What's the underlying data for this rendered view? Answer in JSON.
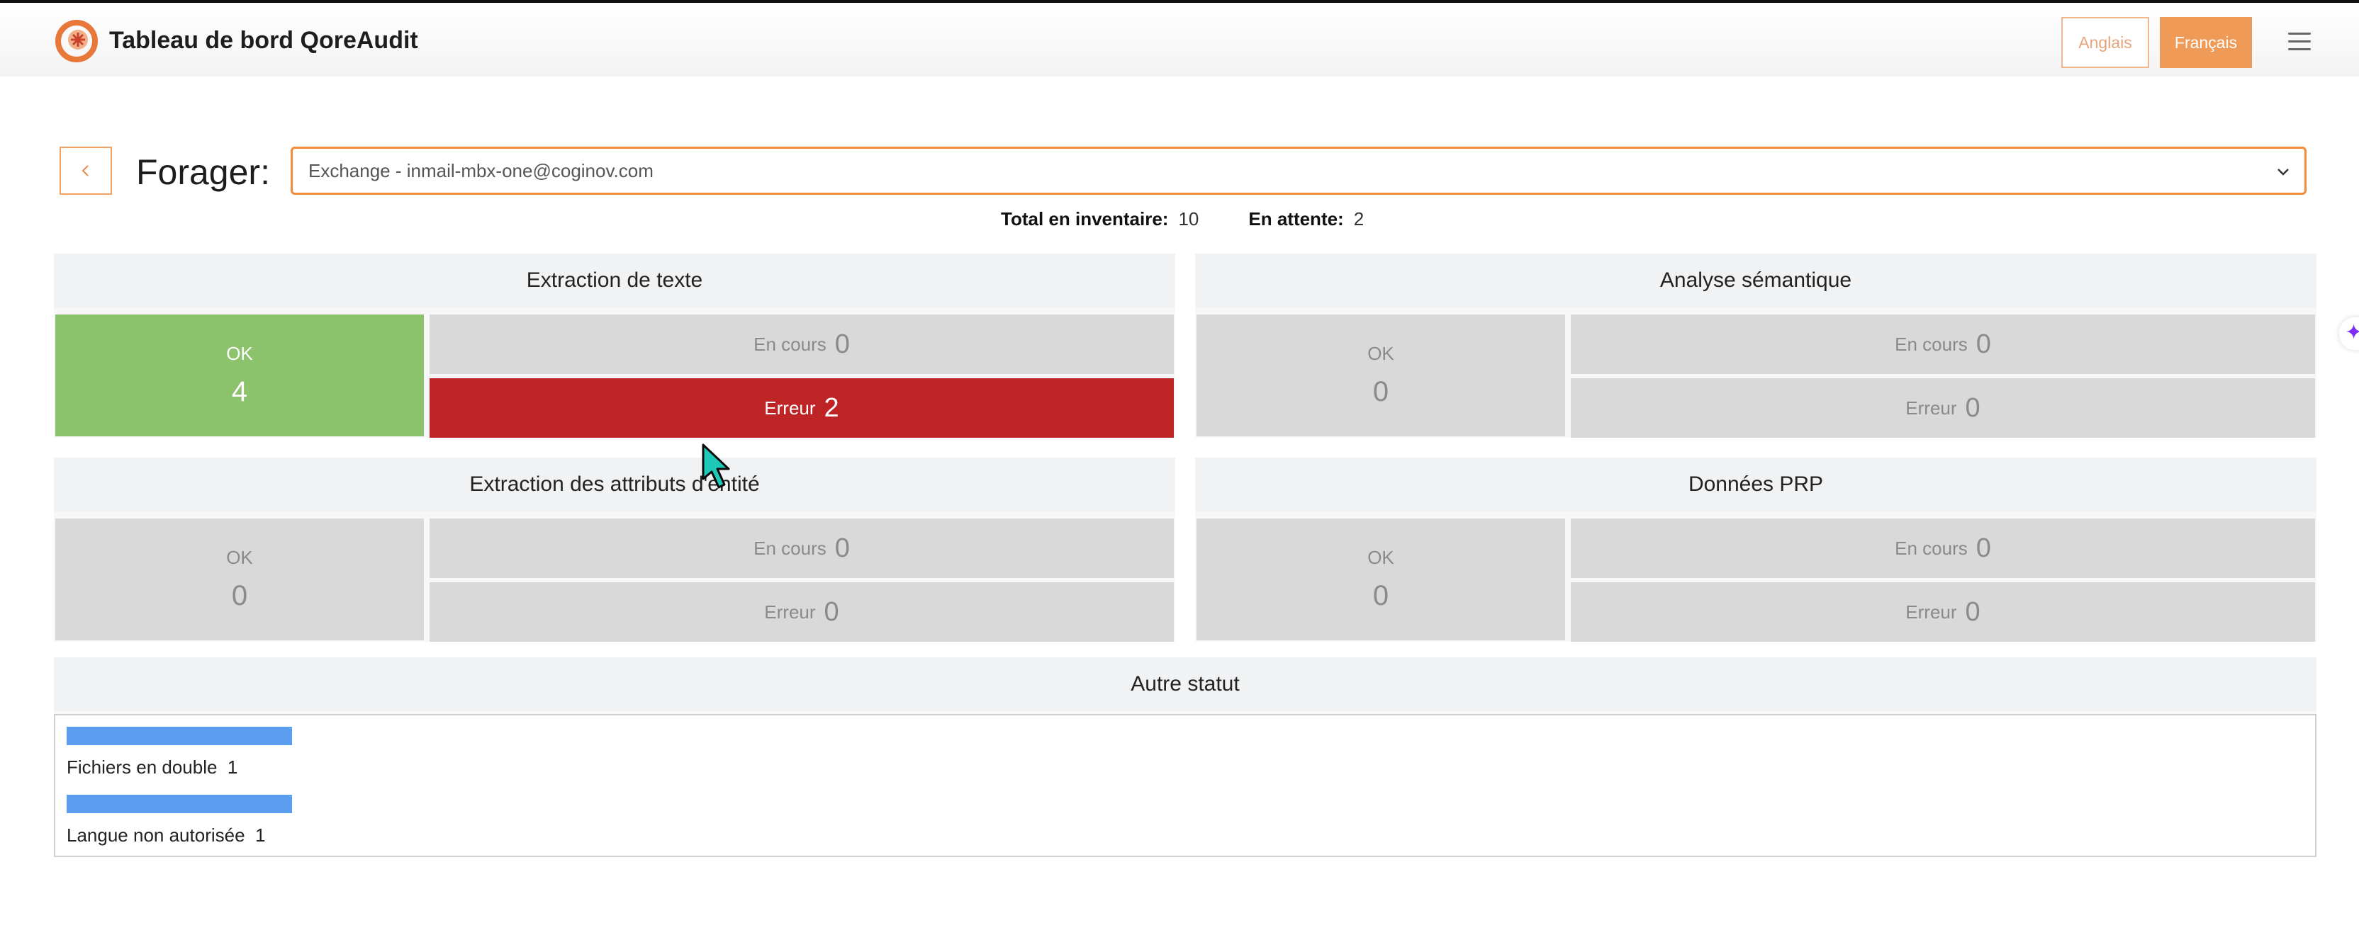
{
  "header": {
    "title": "Tableau de bord QoreAudit",
    "lang_en": "Anglais",
    "lang_fr": "Français",
    "accent": "#f09a57"
  },
  "forager": {
    "label": "Forager:",
    "selected": "Exchange - inmail-mbx-one@coginov.com"
  },
  "totals": {
    "inventory_label": "Total en inventaire:",
    "inventory_value": "10",
    "pending_label": "En attente:",
    "pending_value": "2"
  },
  "cards": {
    "text_extraction": {
      "title": "Extraction de texte",
      "ok_label": "OK",
      "ok_value": "4",
      "in_progress_label": "En cours",
      "in_progress_value": "0",
      "error_label": "Erreur",
      "error_value": "2"
    },
    "semantic": {
      "title": "Analyse sémantique",
      "ok_label": "OK",
      "ok_value": "0",
      "in_progress_label": "En cours",
      "in_progress_value": "0",
      "error_label": "Erreur",
      "error_value": "0"
    },
    "entity": {
      "title": "Extraction des attributs d'entité",
      "ok_label": "OK",
      "ok_value": "0",
      "in_progress_label": "En cours",
      "in_progress_value": "0",
      "error_label": "Erreur",
      "error_value": "0"
    },
    "prp": {
      "title": "Données PRP",
      "ok_label": "OK",
      "ok_value": "0",
      "in_progress_label": "En cours",
      "in_progress_value": "0",
      "error_label": "Erreur",
      "error_value": "0"
    }
  },
  "other_status": {
    "title": "Autre statut",
    "items": [
      {
        "label": "Fichiers en double",
        "value": "1"
      },
      {
        "label": "Langue non autorisée",
        "value": "1"
      }
    ]
  },
  "colors": {
    "ok_green": "#8dc26d",
    "error_red": "#be2325",
    "neutral_grey": "#d9d9d9",
    "bar_blue": "#5c9df0"
  }
}
